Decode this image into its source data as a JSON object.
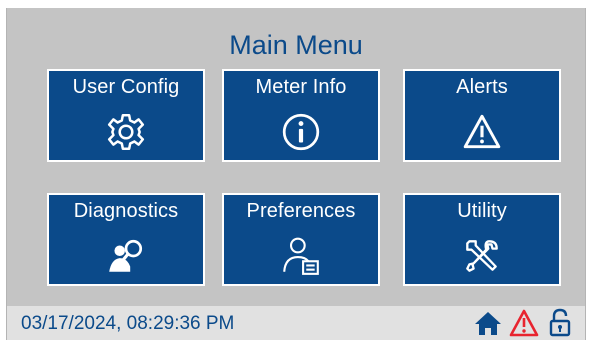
{
  "header": {
    "title": "Main Menu"
  },
  "tiles": [
    {
      "label": "User Config",
      "icon": "gear-icon"
    },
    {
      "label": "Meter Info",
      "icon": "info-icon"
    },
    {
      "label": "Alerts",
      "icon": "warning-icon"
    },
    {
      "label": "Diagnostics",
      "icon": "magnifier-person-icon"
    },
    {
      "label": "Preferences",
      "icon": "user-settings-icon"
    },
    {
      "label": "Utility",
      "icon": "tools-icon"
    }
  ],
  "status": {
    "datetime": "03/17/2024, 08:29:36 PM",
    "icons": [
      "home-icon",
      "alarm-warning-icon",
      "unlock-icon"
    ]
  },
  "colors": {
    "primary": "#0b4a8a",
    "background": "#c4c4c4",
    "statusbar": "#e1e1e1",
    "alert": "#e8242f"
  }
}
